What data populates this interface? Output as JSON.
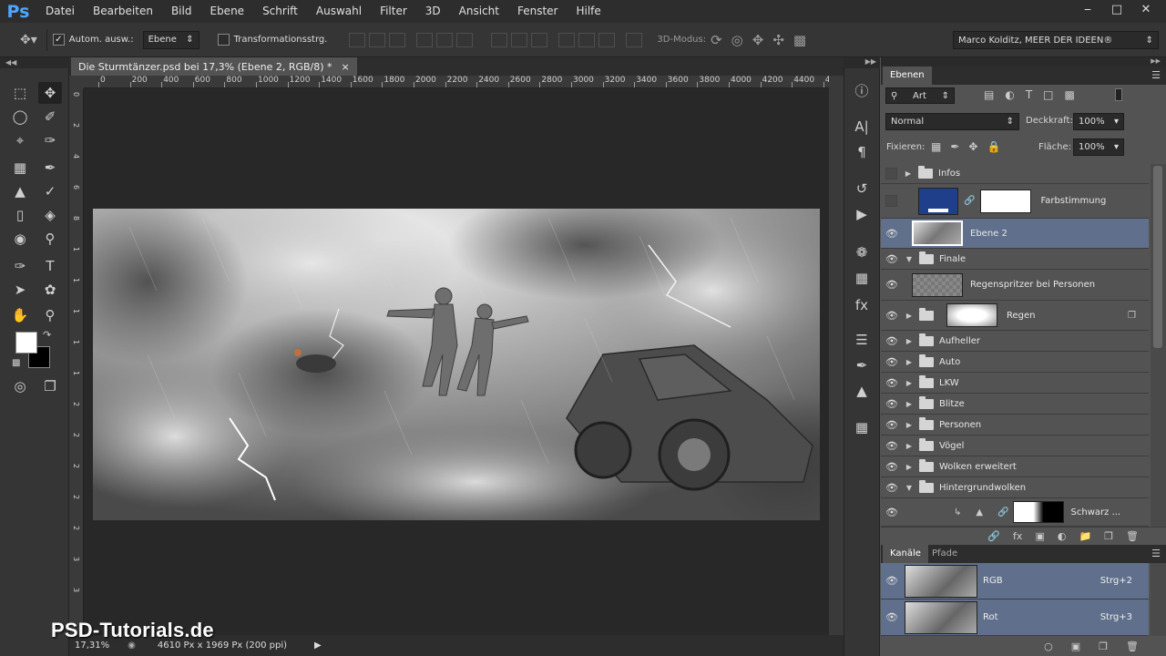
{
  "menubar": {
    "app_logo": "Ps",
    "items": [
      "Datei",
      "Bearbeiten",
      "Bild",
      "Ebene",
      "Schrift",
      "Auswahl",
      "Filter",
      "3D",
      "Ansicht",
      "Fenster",
      "Hilfe"
    ]
  },
  "options": {
    "auto_select_label": "Autom. ausw.:",
    "auto_select_value": "Ebene",
    "transform_label": "Transformationsstrg.",
    "mode_3d_label": "3D-Modus:",
    "workspace_value": "Marco Kolditz, MEER DER IDEEN®"
  },
  "document": {
    "tab_title": "Die Sturmtänzer.psd bei 17,3% (Ebene 2, RGB/8) *",
    "tab_close": "×",
    "ruler_top": [
      "0",
      "200",
      "400",
      "600",
      "800",
      "1000",
      "1200",
      "1400",
      "1600",
      "1800",
      "2000",
      "2200",
      "2400",
      "2600",
      "2800",
      "3000",
      "3200",
      "3400",
      "3600",
      "3800",
      "4000",
      "4200",
      "4400",
      "4"
    ],
    "ruler_left": [
      "0",
      "2",
      "4",
      "6",
      "8",
      "1",
      "1",
      "1",
      "1",
      "1",
      "2",
      "2",
      "2",
      "2",
      "2",
      "3",
      "3"
    ],
    "zoom": "17,31%",
    "doc_size": "4610 Px x 1969 Px (200 ppi)"
  },
  "watermark": "PSD-Tutorials.de",
  "layers_panel": {
    "tab_label": "Ebenen",
    "filter_value": "Art",
    "blend_mode": "Normal",
    "opacity_label": "Deckkraft:",
    "opacity_value": "100%",
    "lock_label": "Fixieren:",
    "fill_label": "Fläche:",
    "fill_value": "100%",
    "layers": [
      {
        "name": "Infos",
        "type": "folder",
        "visible": false
      },
      {
        "name": "Farbstimmung",
        "type": "adjustment",
        "visible": false
      },
      {
        "name": "Ebene 2",
        "type": "pixel",
        "visible": true,
        "selected": true
      },
      {
        "name": "Finale",
        "type": "folder-open",
        "visible": true
      },
      {
        "name": "Regenspritzer bei Personen",
        "type": "pixel-transparent",
        "visible": true
      },
      {
        "name": "Regen",
        "type": "smart-folder",
        "visible": true
      },
      {
        "name": "Aufheller",
        "type": "folder",
        "visible": true
      },
      {
        "name": "Auto",
        "type": "folder",
        "visible": true
      },
      {
        "name": "LKW",
        "type": "folder",
        "visible": true
      },
      {
        "name": "Blitze",
        "type": "folder",
        "visible": true
      },
      {
        "name": "Personen",
        "type": "folder",
        "visible": true
      },
      {
        "name": "Vögel",
        "type": "folder",
        "visible": true
      },
      {
        "name": "Wolken erweitert",
        "type": "folder",
        "visible": true
      },
      {
        "name": "Hintergrundwolken",
        "type": "folder-open",
        "visible": true
      },
      {
        "name": "Schwarz ...",
        "type": "levels",
        "visible": true
      }
    ]
  },
  "channels_panel": {
    "tab_active": "Kanäle",
    "tab_other": "Pfade",
    "channels": [
      {
        "name": "RGB",
        "shortcut": "Strg+2"
      },
      {
        "name": "Rot",
        "shortcut": "Strg+3"
      }
    ]
  },
  "colors": {
    "accent": "#60708c",
    "foreground": "#ffffff",
    "background": "#000000",
    "farbstimmung_swatch": "#1f3f8a"
  }
}
